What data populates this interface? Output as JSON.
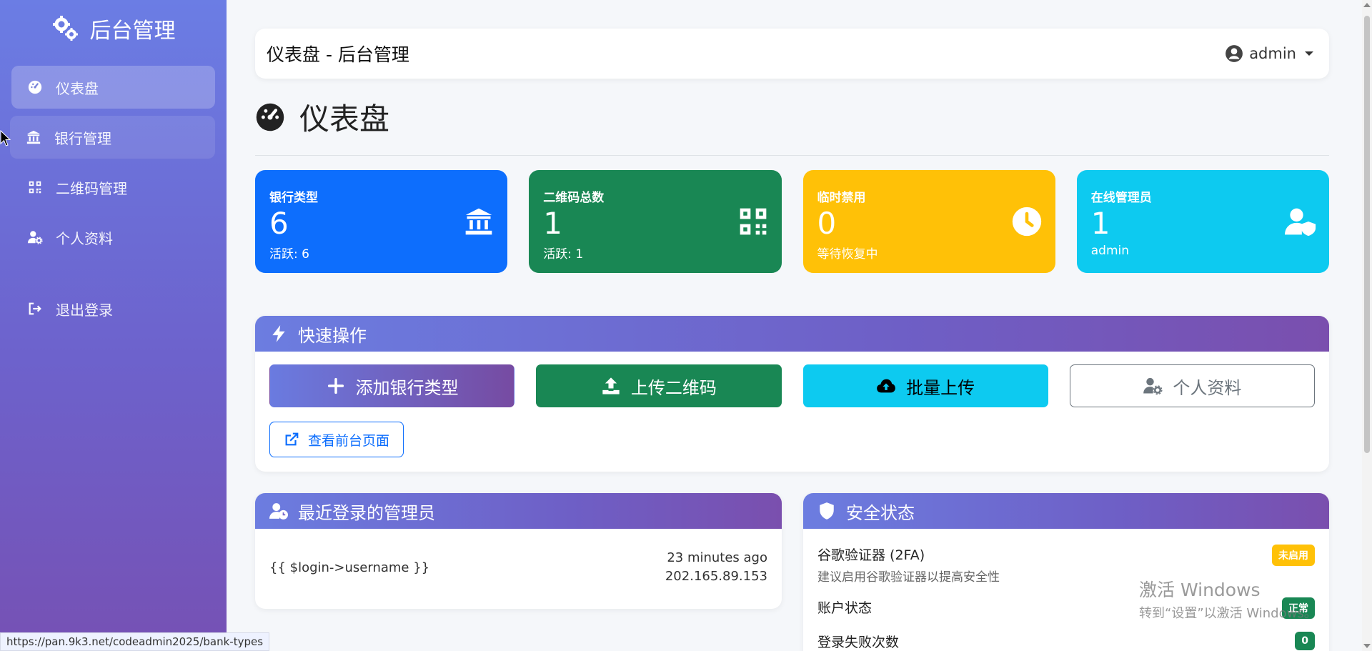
{
  "sidebar": {
    "brand": "后台管理",
    "items": [
      {
        "label": "仪表盘",
        "icon": "tachometer-icon"
      },
      {
        "label": "银行管理",
        "icon": "bank-icon"
      },
      {
        "label": "二维码管理",
        "icon": "qrcode-icon"
      },
      {
        "label": "个人资料",
        "icon": "user-cog-icon"
      },
      {
        "label": "退出登录",
        "icon": "logout-icon"
      }
    ]
  },
  "topbar": {
    "title": "仪表盘 - 后台管理",
    "user": "admin"
  },
  "page": {
    "title": "仪表盘"
  },
  "stats": [
    {
      "label": "银行类型",
      "value": "6",
      "sub": "活跃: 6",
      "color": "#0d6efd",
      "icon": "bank-icon"
    },
    {
      "label": "二维码总数",
      "value": "1",
      "sub": "活跃: 1",
      "color": "#198754",
      "icon": "qrcode-icon"
    },
    {
      "label": "临时禁用",
      "value": "0",
      "sub": "等待恢复中",
      "color": "#ffc107",
      "icon": "clock-icon"
    },
    {
      "label": "在线管理员",
      "value": "1",
      "sub": "admin",
      "color": "#0dcaf0",
      "icon": "user-shield-icon"
    }
  ],
  "quick": {
    "title": "快速操作",
    "buttons": [
      "添加银行类型",
      "上传二维码",
      "批量上传",
      "个人资料"
    ],
    "link": "查看前台页面"
  },
  "recent": {
    "title": "最近登录的管理员",
    "username": "{{ $login->username }}",
    "time": "23 minutes ago",
    "ip": "202.165.89.153"
  },
  "security": {
    "title": "安全状态",
    "items": [
      {
        "title": "谷歌验证器 (2FA)",
        "desc": "建议启用谷歌验证器以提高安全性",
        "badge": "未启用"
      },
      {
        "title": "账户状态",
        "badge": "正常"
      },
      {
        "title": "登录失败次数",
        "badge": "0"
      }
    ]
  },
  "statusbar": {
    "url": "https://pan.9k3.net/codeadmin2025/bank-types"
  },
  "watermark": {
    "line1": "激活 Windows",
    "line2": "转到“设置”以激活 Windows。"
  }
}
